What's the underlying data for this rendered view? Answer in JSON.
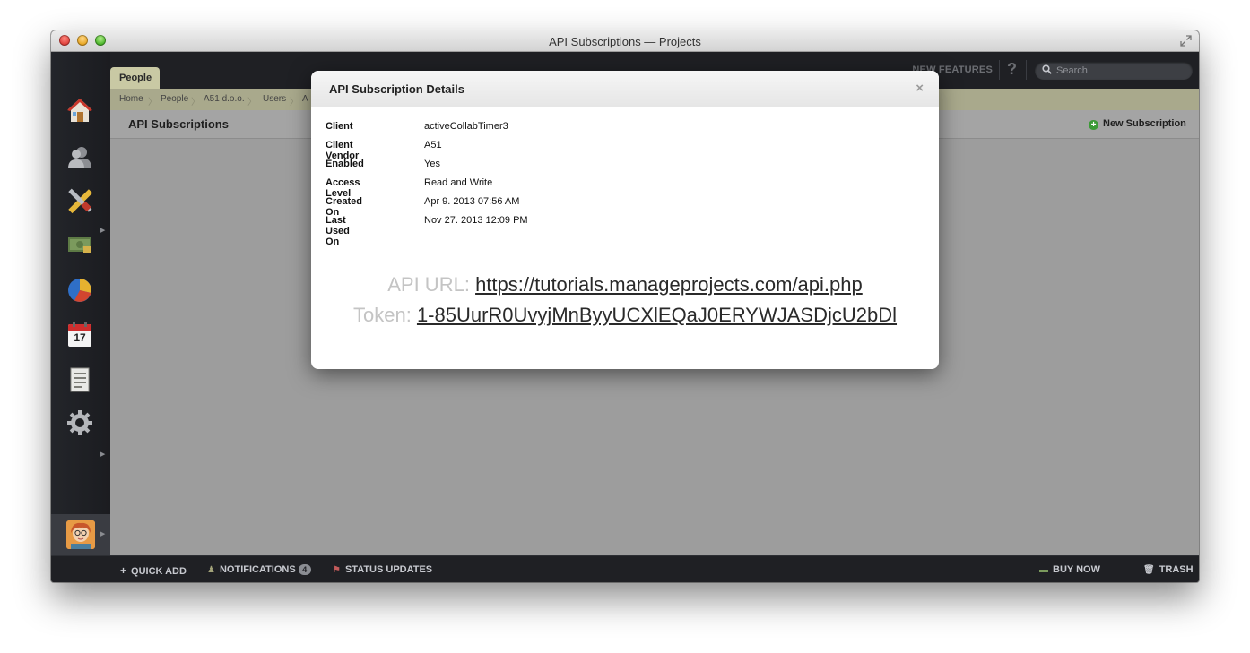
{
  "window": {
    "title": "API Subscriptions — Projects"
  },
  "tabs": {
    "active": "People"
  },
  "topbar": {
    "new_features": "NEW FEATURES",
    "help": "?",
    "search_placeholder": "Search"
  },
  "breadcrumbs": [
    "Home",
    "People",
    "A51 d.o.o.",
    "Users",
    "A"
  ],
  "page": {
    "title": "API Subscriptions",
    "new_subscription": "New Subscription"
  },
  "sidebar": {
    "items": [
      {
        "name": "home-icon"
      },
      {
        "name": "people-icon"
      },
      {
        "name": "projects-tools-icon"
      },
      {
        "name": "invoicing-money-icon"
      },
      {
        "name": "reports-chart-icon"
      },
      {
        "name": "calendar-icon",
        "day": "17"
      },
      {
        "name": "documents-icon"
      },
      {
        "name": "settings-gear-icon"
      }
    ]
  },
  "bottombar": {
    "quick_add": "QUICK ADD",
    "notifications": "NOTIFICATIONS",
    "notifications_count": "4",
    "status_updates": "STATUS UPDATES",
    "buy_now": "BUY NOW",
    "trash": "TRASH"
  },
  "modal": {
    "title": "API Subscription Details",
    "close": "×",
    "details": [
      {
        "label": "Client",
        "value": "activeCollabTimer3"
      },
      {
        "label": "Client Vendor",
        "value": "A51"
      },
      {
        "label": "Enabled",
        "value": "Yes"
      },
      {
        "label": "Access Level",
        "value": "Read and Write"
      },
      {
        "label": "Created On",
        "value": "Apr 9. 2013 07:56 AM"
      },
      {
        "label": "Last Used On",
        "value": "Nov 27. 2013 12:09 PM"
      }
    ],
    "api_url_label": "API URL:",
    "api_url": "https://tutorials.manageprojects.com/api.php",
    "token_label": "Token:",
    "token": "1-85UurR0UvyjMnByyUCXlEQaJ0ERYWJASDjcU2bDl"
  }
}
